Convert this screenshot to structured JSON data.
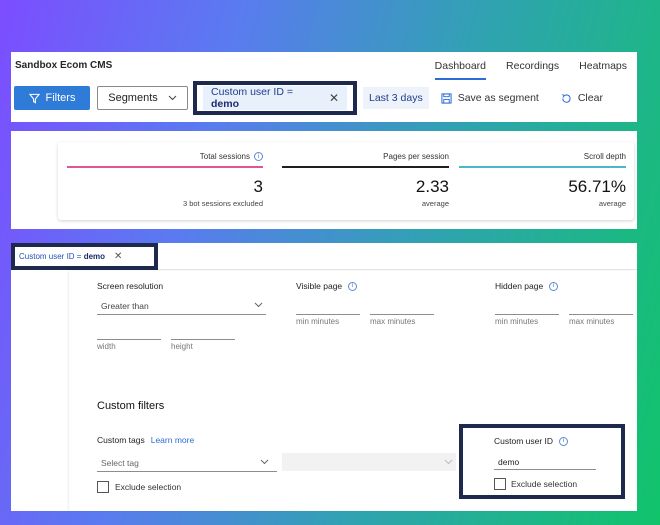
{
  "header": {
    "app_title": "Sandbox Ecom CMS",
    "nav": [
      "Dashboard",
      "Recordings",
      "Heatmaps"
    ]
  },
  "toolbar": {
    "filters_label": "Filters",
    "segments_label": "Segments",
    "chip_prefix": "Custom user ID = ",
    "chip_value": "demo",
    "date_range": "Last 3 days",
    "save_segment": "Save as segment",
    "clear": "Clear"
  },
  "metrics": [
    {
      "label": "Total sessions",
      "value": "3",
      "sub_count": "3",
      "sub_text": " bot sessions excluded",
      "color": "#e0559a"
    },
    {
      "label": "Pages per session",
      "value": "2.33",
      "sub_text": "average",
      "color": "#1f1f1f"
    },
    {
      "label": "Scroll depth",
      "value": "56.71%",
      "sub_text": "average",
      "color": "#4db6c8"
    }
  ],
  "filter_chip": {
    "prefix": "Custom user ID = ",
    "value": "demo"
  },
  "filters": {
    "screen_resolution": {
      "label": "Screen resolution",
      "operator": "Greater than",
      "width_hint": "width",
      "height_hint": "height"
    },
    "visible_page": {
      "label": "Visible page",
      "min_hint": "min minutes",
      "max_hint": "max minutes"
    },
    "hidden_page": {
      "label": "Hidden page",
      "min_hint": "min minutes",
      "max_hint": "max minutes"
    },
    "custom_filters_title": "Custom filters",
    "custom_tags": {
      "label": "Custom tags",
      "learn_more": "Learn more",
      "placeholder": "Select tag",
      "exclude": "Exclude selection"
    },
    "custom_user_id": {
      "label": "Custom user ID",
      "value": "demo",
      "exclude": "Exclude selection"
    }
  },
  "colors": {
    "primary": "#2f7bd8",
    "highlight_border": "#1d2a4d",
    "chip_bg": "#e8f0fb"
  }
}
